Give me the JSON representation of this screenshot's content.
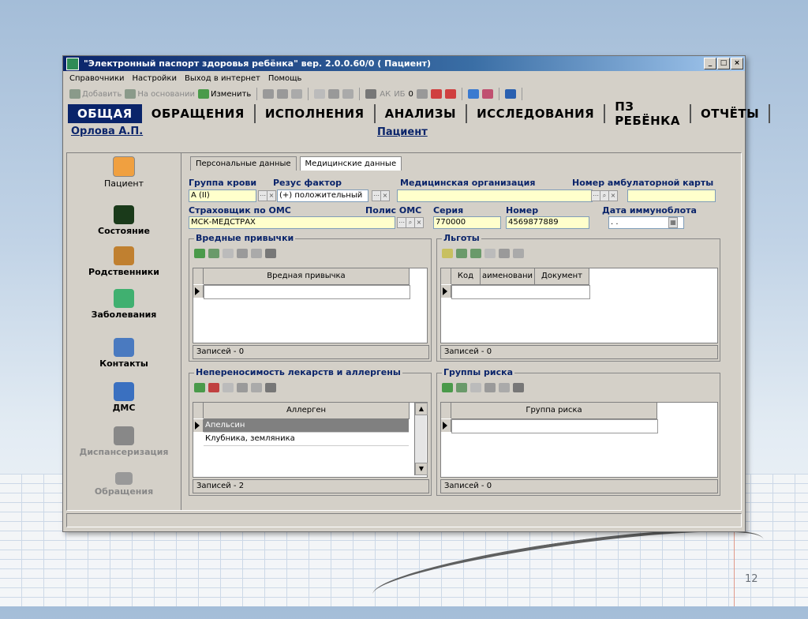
{
  "window": {
    "title": "\"Электронный паспорт здоровья ребёнка\" вер. 2.0.0.60/0 ( Пациент)",
    "controls": [
      "_",
      "□",
      "×"
    ]
  },
  "menu": [
    "Справочники",
    "Настройки",
    "Выход в интернет",
    "Помощь"
  ],
  "toolbar": {
    "add": "Добавить",
    "based_on": "На основании",
    "edit": "Изменить",
    "ak": "АК",
    "ib": "ИБ",
    "zero": "0"
  },
  "tabs": [
    "ОБЩАЯ",
    "ОБРАЩЕНИЯ",
    "ИСПОЛНЕНИЯ",
    "АНАЛИЗЫ",
    "ИССЛЕДОВАНИЯ",
    "ПЗ РЕБЁНКА",
    "ОТЧЁТЫ"
  ],
  "header": {
    "user": "Орлова А.П.",
    "title": "Пациент"
  },
  "sidebar": [
    {
      "label": "Пациент",
      "icon": "patient-icon"
    },
    {
      "label": "Состояние",
      "icon": "monitor-icon"
    },
    {
      "label": "Родственники",
      "icon": "relatives-icon"
    },
    {
      "label": "Заболевания",
      "icon": "doctor-icon"
    },
    {
      "label": "Контакты",
      "icon": "contacts-icon"
    },
    {
      "label": "ДМС",
      "icon": "dms-icon"
    },
    {
      "label": "Диспансеризация",
      "icon": "dispensary-icon"
    },
    {
      "label": "Обращения",
      "icon": "arrow-icon"
    }
  ],
  "subtabs": [
    "Персональные данные",
    "Медицинские данные"
  ],
  "fields": {
    "blood_group": {
      "label": "Группа крови",
      "value": "A (II)"
    },
    "rh": {
      "label": "Резус фактор",
      "value": "(+) положительный"
    },
    "med_org": {
      "label": "Медицинская организация",
      "value": ""
    },
    "card_no": {
      "label": "Номер амбулаторной карты",
      "value": ""
    },
    "insurer": {
      "label": "Страховщик по ОМС",
      "value": "МСК-МЕДСТРАХ"
    },
    "policy": {
      "label": "Полис ОМС"
    },
    "series": {
      "label": "Серия",
      "value": "770000"
    },
    "number": {
      "label": "Номер",
      "value": "4569877889"
    },
    "immuno_date": {
      "label": "Дата иммуноблота",
      "value": " . ."
    }
  },
  "groups": {
    "habits": {
      "title": "Вредные привычки",
      "columns": [
        "Вредная привычка"
      ],
      "rows": [],
      "footer": "Записей - 0"
    },
    "benefits": {
      "title": "Льготы",
      "columns": [
        "Код",
        "аименовани",
        "Документ"
      ],
      "rows": [],
      "footer": "Записей - 0"
    },
    "allergy": {
      "title": "Непереносимость лекарств и аллергены",
      "columns": [
        "Аллерген"
      ],
      "rows": [
        "Апельсин",
        "Клубника, земляника"
      ],
      "footer": "Записей - 2"
    },
    "risk": {
      "title": "Группы риска",
      "columns": [
        "Группа риска"
      ],
      "rows": [],
      "footer": "Записей - 0"
    }
  },
  "slide_number": "12"
}
